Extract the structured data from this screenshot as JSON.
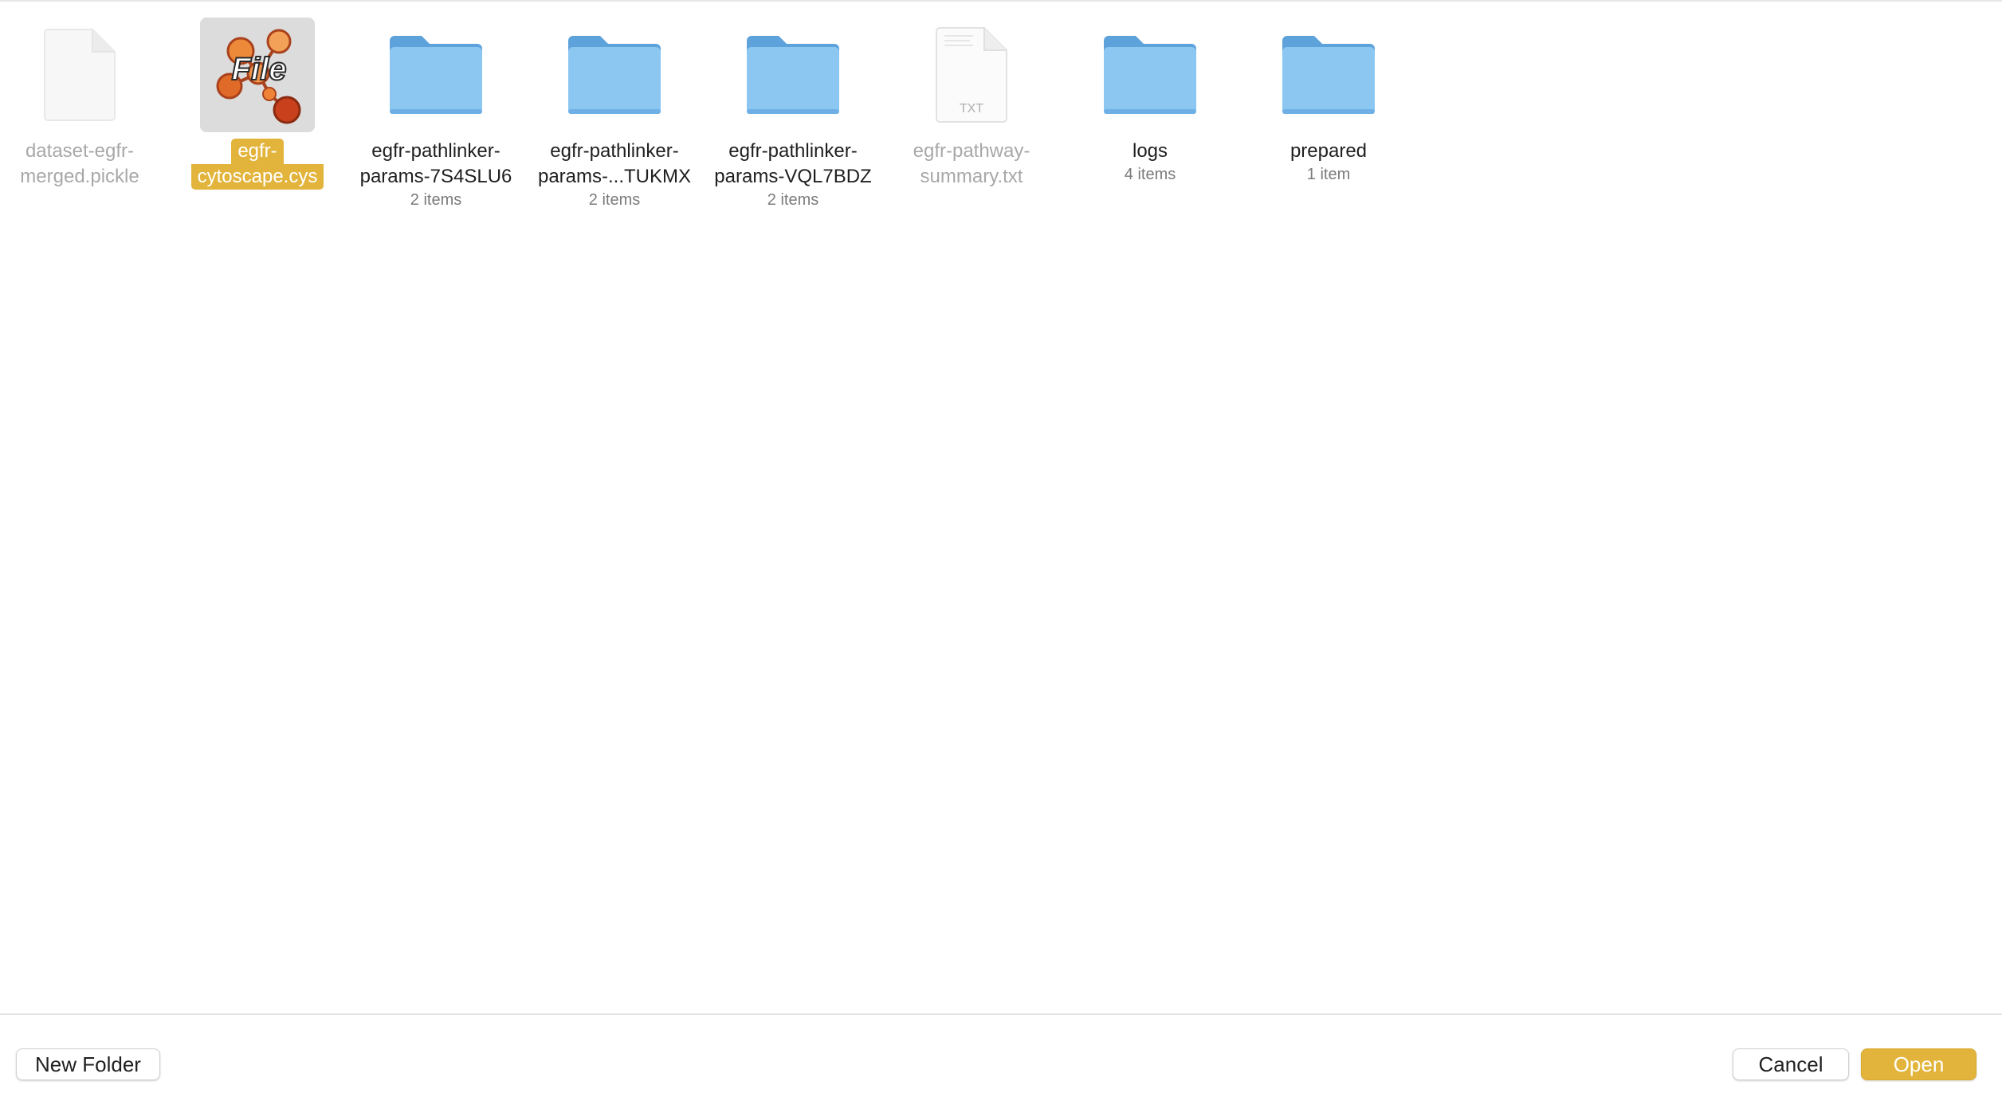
{
  "files": [
    {
      "name_line1": "dataset-egfr-",
      "name_line2": "merged.pickle",
      "count": "",
      "kind": "generic-file-icon"
    },
    {
      "name_line1": "egfr-",
      "name_line2": "cytoscape.cys",
      "count": "",
      "kind": "cytoscape-file-icon",
      "icon_text": "File",
      "selected": true
    },
    {
      "name_line1": "egfr-pathlinker-",
      "name_line2": "params-7S4SLU6",
      "count": "2 items",
      "kind": "folder-icon"
    },
    {
      "name_line1": "egfr-pathlinker-",
      "name_line2": "params-...TUKMX",
      "count": "2 items",
      "kind": "folder-icon"
    },
    {
      "name_line1": "egfr-pathlinker-",
      "name_line2": "params-VQL7BDZ",
      "count": "2 items",
      "kind": "folder-icon"
    },
    {
      "name_line1": "egfr-pathway-",
      "name_line2": "summary.txt",
      "count": "",
      "kind": "txt-file-icon",
      "icon_text": "TXT"
    },
    {
      "name_line1": "logs",
      "name_line2": "",
      "count": "4 items",
      "kind": "folder-icon"
    },
    {
      "name_line1": "prepared",
      "name_line2": "",
      "count": "1 item",
      "kind": "folder-icon"
    }
  ],
  "buttons": {
    "new_folder": "New Folder",
    "cancel": "Cancel",
    "open": "Open"
  },
  "colors": {
    "accent": "#e3b43b",
    "folder": "#8cc7f2",
    "folder_tab": "#5ea2dc"
  }
}
